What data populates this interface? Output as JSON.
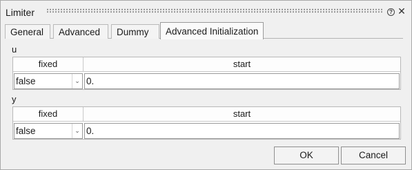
{
  "window": {
    "title": "Limiter"
  },
  "tabs": [
    {
      "label": "General"
    },
    {
      "label": "Advanced"
    },
    {
      "label": "Dummy"
    },
    {
      "label": "Advanced Initialization",
      "active": true
    }
  ],
  "sections": [
    {
      "label": "u",
      "columns": {
        "fixed": "fixed",
        "start": "start"
      },
      "fixed_value": "false",
      "start_value": "0."
    },
    {
      "label": "y",
      "columns": {
        "fixed": "fixed",
        "start": "start"
      },
      "fixed_value": "false",
      "start_value": "0."
    }
  ],
  "buttons": {
    "ok": "OK",
    "cancel": "Cancel"
  },
  "icons": {
    "help": "question-circle-icon",
    "close": "close-icon",
    "dropdown": "chevron-down-icon"
  }
}
